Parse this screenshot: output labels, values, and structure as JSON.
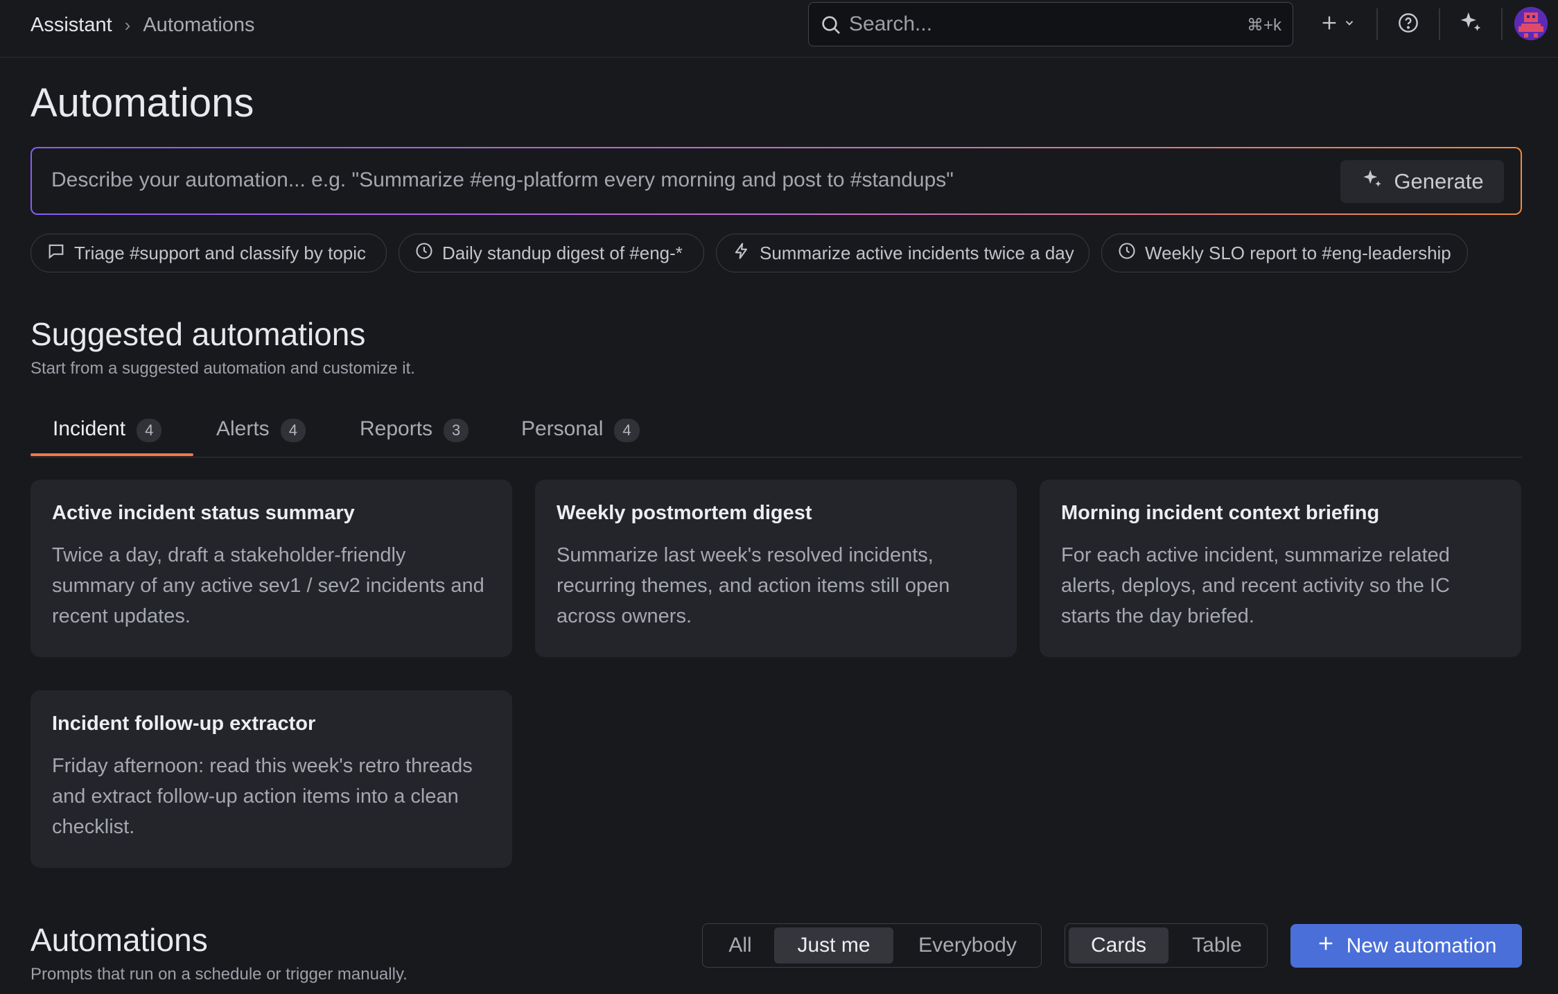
{
  "breadcrumb": {
    "root": "Assistant",
    "separator": "›",
    "current": "Automations"
  },
  "search": {
    "placeholder": "Search...",
    "shortcut": "⌘+k"
  },
  "topbar_icons": [
    "plus-icon",
    "chevron-down-icon",
    "help-icon",
    "sparkle-icon",
    "avatar"
  ],
  "page_title": "Automations",
  "generator": {
    "placeholder": "Describe your automation... e.g. \"Summarize #eng-platform every morning and post to #standups\"",
    "button_label": "Generate"
  },
  "quick_chips": [
    {
      "icon": "chat-icon",
      "label": "Triage #support and classify by topic"
    },
    {
      "icon": "clock-icon",
      "label": "Daily standup digest of #eng-*"
    },
    {
      "icon": "bolt-icon",
      "label": "Summarize active incidents twice a day"
    },
    {
      "icon": "clock-icon",
      "label": "Weekly SLO report to #eng-leadership"
    }
  ],
  "suggested": {
    "title": "Suggested automations",
    "subtitle": "Start from a suggested automation and customize it.",
    "tabs": [
      {
        "label": "Incident",
        "count": "4",
        "active": true
      },
      {
        "label": "Alerts",
        "count": "4",
        "active": false
      },
      {
        "label": "Reports",
        "count": "3",
        "active": false
      },
      {
        "label": "Personal",
        "count": "4",
        "active": false
      }
    ],
    "cards": [
      {
        "title": "Active incident status summary",
        "description": "Twice a day, draft a stakeholder-friendly summary of any active sev1 / sev2 incidents and recent updates."
      },
      {
        "title": "Weekly postmortem digest",
        "description": "Summarize last week's resolved incidents, recurring themes, and action items still open across owners."
      },
      {
        "title": "Morning incident context briefing",
        "description": "For each active incident, summarize related alerts, deploys, and recent activity so the IC starts the day briefed."
      },
      {
        "title": "Incident follow-up extractor",
        "description": "Friday afternoon: read this week's retro threads and extract follow-up action items into a clean checklist."
      }
    ]
  },
  "automations": {
    "title": "Automations",
    "subtitle": "Prompts that run on a schedule or trigger manually.",
    "owner_filter": {
      "options": [
        "All",
        "Just me",
        "Everybody"
      ],
      "selected": "Just me"
    },
    "view_toggle": {
      "options": [
        "Cards",
        "Table"
      ],
      "selected": "Cards"
    },
    "new_button": "New automation"
  },
  "colors": {
    "background": "#18191d",
    "accent_tab": "#f0794a",
    "primary_button": "#4a6fd9"
  }
}
